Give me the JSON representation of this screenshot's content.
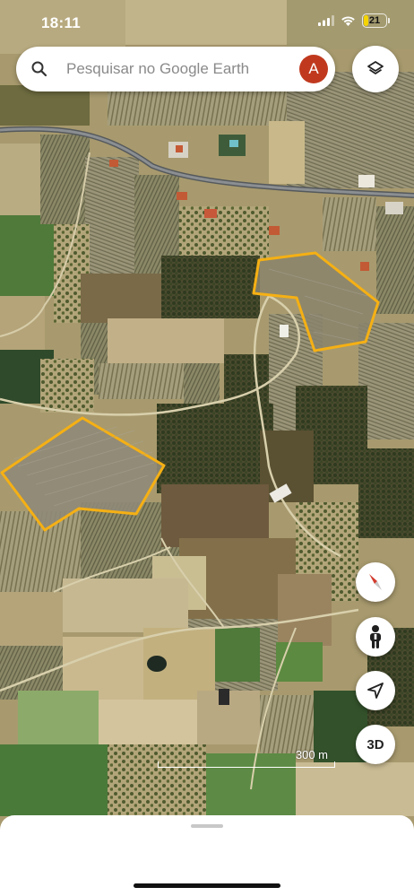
{
  "status_bar": {
    "time": "18:11",
    "battery_level": "21",
    "battery_color": "#f5d400"
  },
  "search": {
    "placeholder": "Pesquisar no Google Earth",
    "icon": "search-icon",
    "avatar_letter": "A",
    "avatar_color": "#c0391e"
  },
  "controls": {
    "layers_icon": "layers-icon",
    "compass_icon": "compass-icon",
    "streetview_icon": "pegman-icon",
    "location_icon": "navigation-arrow-icon",
    "button_3d_label": "3D"
  },
  "map": {
    "type": "satellite",
    "scale_label": "300 m",
    "drawn_polygon_color": "#f5b014",
    "drawn_polygon_count": 2
  }
}
